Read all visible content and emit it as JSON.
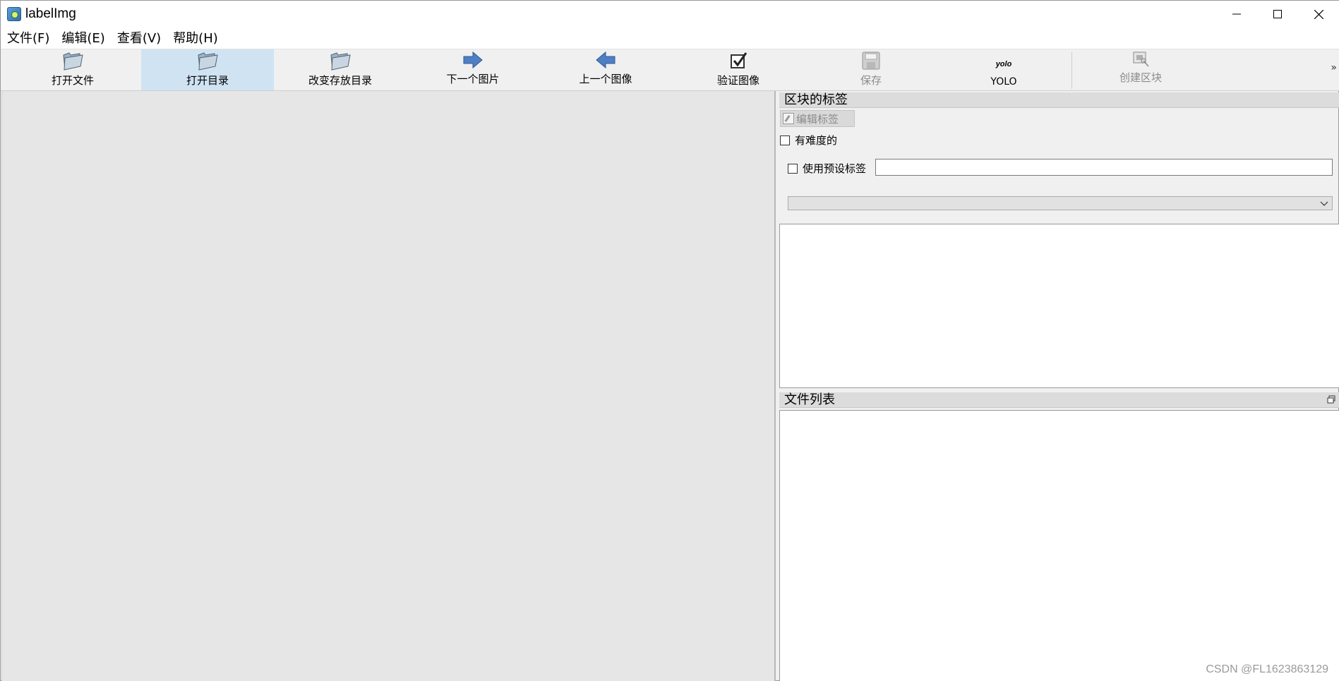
{
  "window": {
    "title": "labelImg",
    "icon": "labelimg-app-icon",
    "controls": [
      "minimize-icon",
      "maximize-icon",
      "close-icon"
    ]
  },
  "menu": {
    "items": [
      {
        "label": "文件(F)"
      },
      {
        "label": "编辑(E)"
      },
      {
        "label": "查看(V)"
      },
      {
        "label": "帮助(H)"
      }
    ]
  },
  "toolbar": {
    "buttons": [
      {
        "label": "打开文件",
        "icon": "folder-open-icon",
        "state": "normal"
      },
      {
        "label": "打开目录",
        "icon": "folder-open-icon",
        "state": "active"
      },
      {
        "label": "改变存放目录",
        "icon": "folder-open-icon",
        "state": "normal"
      },
      {
        "label": "下一个图片",
        "icon": "arrow-right-icon",
        "state": "normal"
      },
      {
        "label": "上一个图像",
        "icon": "arrow-left-icon",
        "state": "normal"
      },
      {
        "label": "验证图像",
        "icon": "checkbox-check-icon",
        "state": "normal"
      },
      {
        "label": "保存",
        "icon": "save-disk-icon",
        "state": "disabled"
      },
      {
        "label": "YOLO",
        "icon_text": "yolo",
        "state": "normal"
      },
      {
        "label": "创建区块",
        "icon": "create-box-icon",
        "state": "disabled"
      }
    ],
    "overflow": "»"
  },
  "box_labels_panel": {
    "title": "区块的标签",
    "edit_label_button": "编辑标签",
    "difficult_checkbox": {
      "label": "有难度的",
      "checked": false
    },
    "default_label_checkbox": {
      "label": "使用预设标签",
      "checked": false
    },
    "default_label_input": {
      "value": ""
    },
    "dropdown": {
      "selected": ""
    }
  },
  "file_list_panel": {
    "title": "文件列表"
  },
  "watermark": "CSDN @FL1623863129",
  "colors": {
    "canvas_bg": "#e6e6e6",
    "active_tool_bg": "#cfe3f3",
    "dock_title_bg": "#dcdcdc"
  }
}
